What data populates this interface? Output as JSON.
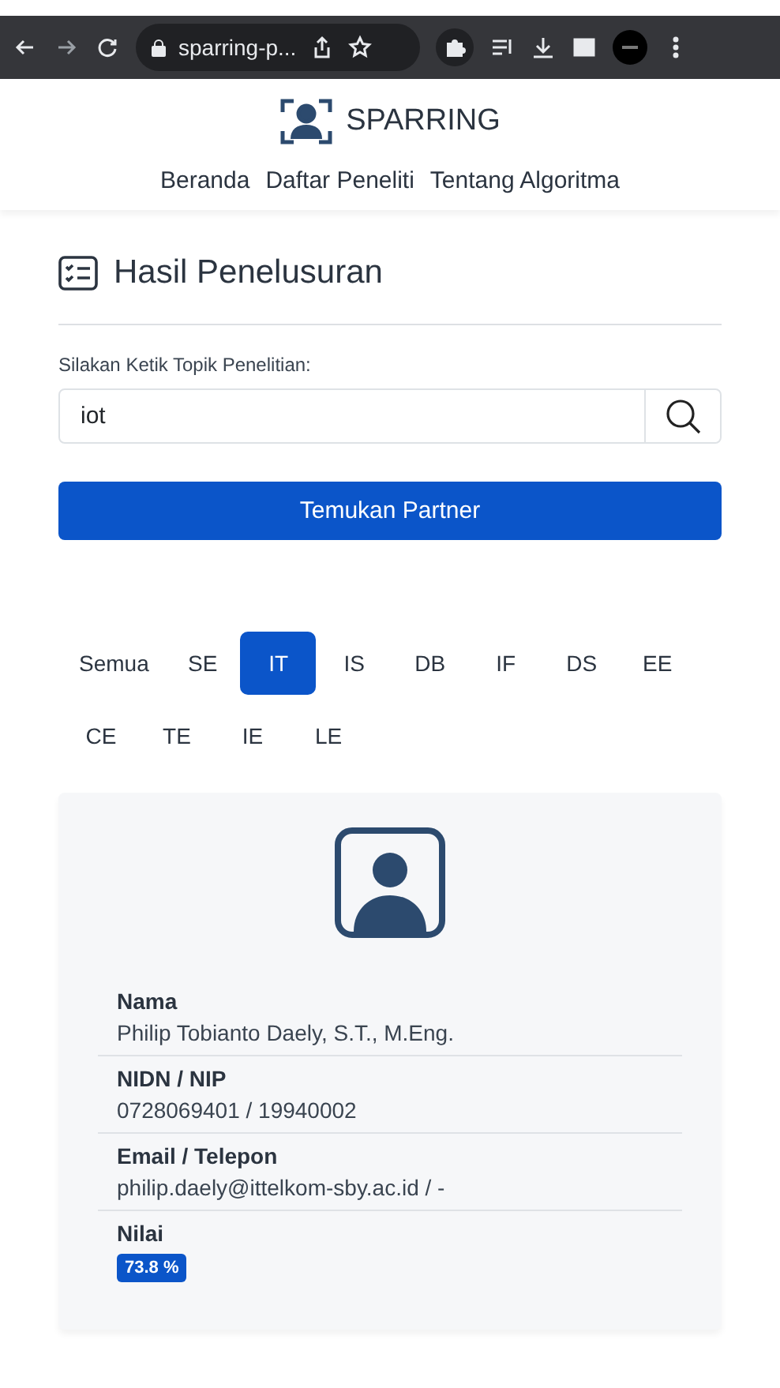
{
  "browser": {
    "url": "sparring-p..."
  },
  "brand": {
    "name": "SPARRING"
  },
  "nav": [
    {
      "label": "Beranda"
    },
    {
      "label": "Daftar Peneliti"
    },
    {
      "label": "Tentang Algoritma"
    }
  ],
  "section": {
    "title": "Hasil Penelusuran"
  },
  "search": {
    "label": "Silakan Ketik Topik Penelitian:",
    "value": "iot"
  },
  "submit": {
    "label": "Temukan Partner"
  },
  "filters": [
    {
      "label": "Semua",
      "selected": false
    },
    {
      "label": "SE",
      "selected": false
    },
    {
      "label": "IT",
      "selected": true
    },
    {
      "label": "IS",
      "selected": false
    },
    {
      "label": "DB",
      "selected": false
    },
    {
      "label": "IF",
      "selected": false
    },
    {
      "label": "DS",
      "selected": false
    },
    {
      "label": "EE",
      "selected": false
    },
    {
      "label": "CE",
      "selected": false
    },
    {
      "label": "TE",
      "selected": false
    },
    {
      "label": "IE",
      "selected": false
    },
    {
      "label": "LE",
      "selected": false
    }
  ],
  "result": {
    "fields": [
      {
        "kind": "text",
        "label": "Nama",
        "value": "Philip Tobianto Daely, S.T., M.Eng."
      },
      {
        "kind": "text",
        "label": "NIDN / NIP",
        "value": "0728069401 / 19940002"
      },
      {
        "kind": "text",
        "label": "Email / Telepon",
        "value": "philip.daely@ittelkom-sby.ac.id / -"
      },
      {
        "kind": "badge",
        "label": "Nilai",
        "value": "73.8 %"
      }
    ]
  }
}
